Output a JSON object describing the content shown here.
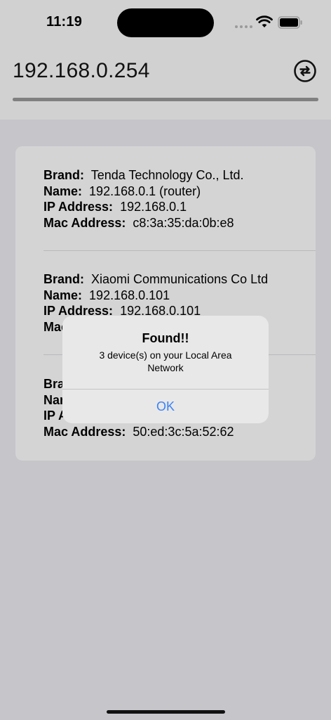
{
  "status_bar": {
    "time": "11:19"
  },
  "header": {
    "ip": "192.168.0.254",
    "progress": 1.0
  },
  "devices": [
    {
      "brand_label": "Brand:",
      "brand": "Tenda Technology Co., Ltd.",
      "name_label": "Name:",
      "name": "192.168.0.1 (router)",
      "ip_label": "IP Address:",
      "ip": "192.168.0.1",
      "mac_label": "Mac Address:",
      "mac": "c8:3a:35:da:0b:e8"
    },
    {
      "brand_label": "Brand:",
      "brand": "Xiaomi Communications Co Ltd",
      "name_label": "Name:",
      "name": "192.168.0.101",
      "ip_label": "IP Address:",
      "ip": "192.168.0.101",
      "mac_label": "Mac Address:",
      "mac": ""
    },
    {
      "brand_label": "Brand:",
      "brand": "",
      "name_label": "Name:",
      "name": "",
      "ip_label": "IP Address:",
      "ip": "",
      "mac_label": "Mac Address:",
      "mac": "50:ed:3c:5a:52:62"
    }
  ],
  "dialog": {
    "title": "Found!!",
    "message": "3 device(s) on your Local Area Network",
    "ok": "OK"
  }
}
